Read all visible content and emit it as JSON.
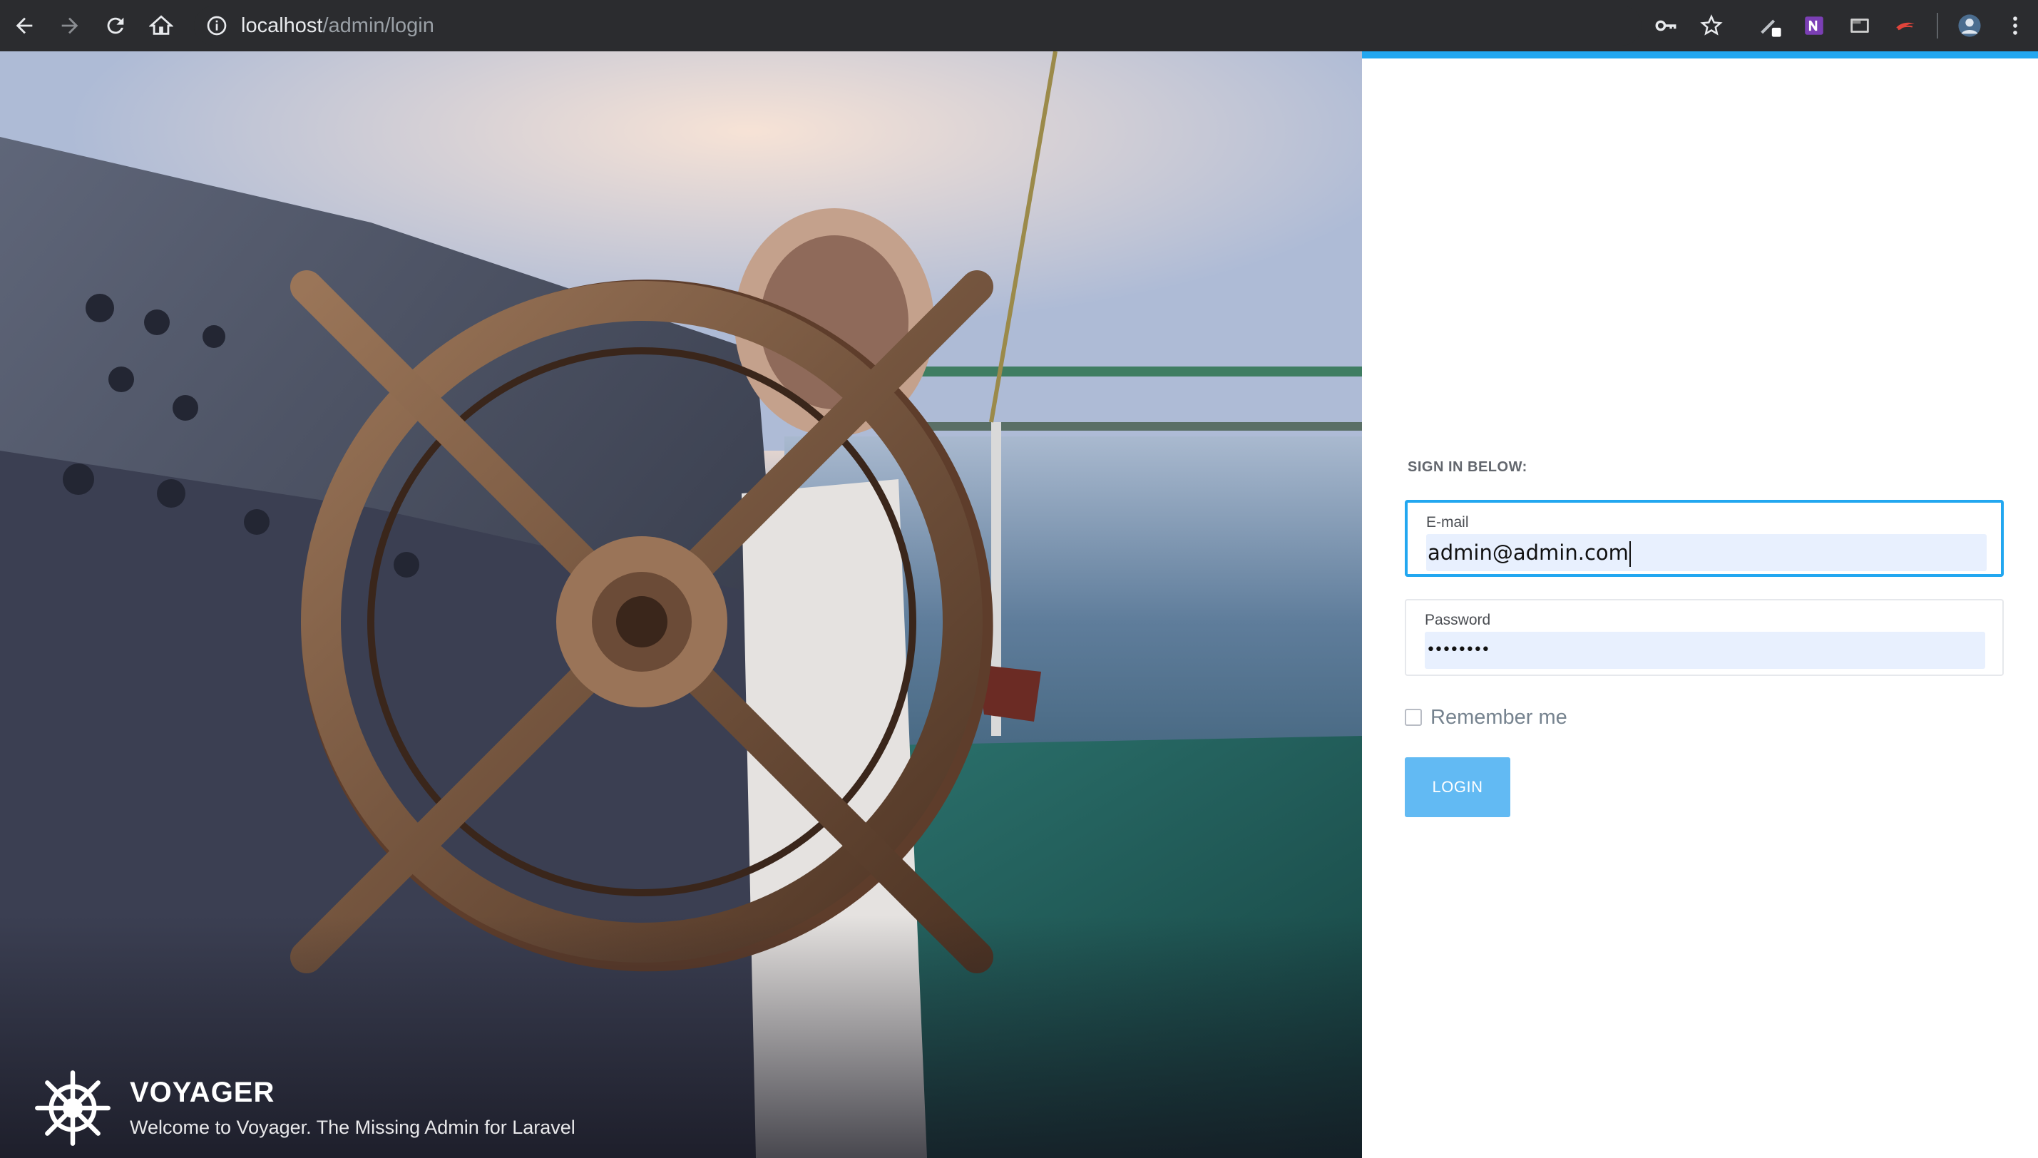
{
  "browser": {
    "url_host": "localhost",
    "url_path": "/admin/login",
    "icons": [
      "back-icon",
      "forward-icon",
      "reload-icon",
      "home-icon",
      "site-info-icon",
      "key-icon",
      "bookmark-star-icon",
      "pen-extension-icon",
      "onenote-extension-icon",
      "screen-capture-extension-icon",
      "extension-icon",
      "profile-avatar-icon",
      "menu-kebab-icon"
    ]
  },
  "hero": {
    "brand_name": "VOYAGER",
    "tagline": "Welcome to Voyager. The Missing Admin for Laravel",
    "logo_icon": "ship-wheel-icon"
  },
  "login": {
    "heading": "SIGN IN BELOW:",
    "email": {
      "label": "E-mail",
      "value": "admin@admin.com"
    },
    "password": {
      "label": "Password",
      "value": "••••••••"
    },
    "remember_label": "Remember me",
    "remember_checked": false,
    "submit_label": "LOGIN"
  },
  "colors": {
    "accent": "#22a7f0",
    "login_button": "#62baf3",
    "autofill_bg": "#e8f0fe",
    "chrome_bar": "#2b2c2f"
  }
}
